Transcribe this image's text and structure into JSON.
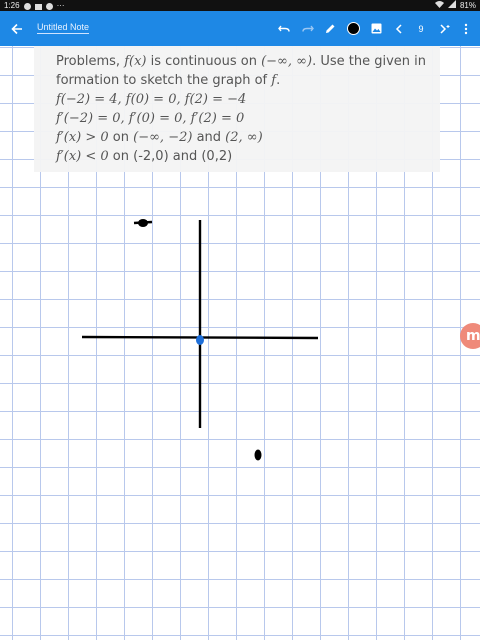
{
  "status_bar": {
    "time": "1:26",
    "battery": "81%",
    "more": "···"
  },
  "toolbar": {
    "title": "Untitled Note",
    "page_number": "9"
  },
  "problem": {
    "line1_a": "Problems, ",
    "line1_b": "f(x)",
    "line1_c": " is continuous on ",
    "line1_d": "(−∞, ∞)",
    "line1_e": ". Use the given in",
    "line2_a": "formation to sketch the graph of ",
    "line2_b": "f",
    "line2_c": ".",
    "line3": "f(−2) = 4, f(0) = 0, f(2) = −4",
    "line4": "f′(−2) = 0, f′(0) = 0, f′(2) = 0",
    "line5_a": "f′(x) > 0",
    "line5_b": " on ",
    "line5_c": "(−∞, −2)",
    "line5_d": " and ",
    "line5_e": "(2, ∞)",
    "line6_a": "f′(x) < 0",
    "line6_b": " on (-2,0) and (0,2)"
  },
  "side_tab_letter": "m",
  "colors": {
    "toolbar": "#1e88e5",
    "grid": "#b8c8ec",
    "ink": "#000000",
    "origin_mark": "#1e6fd9",
    "side_tab": "#ef8a7a"
  }
}
